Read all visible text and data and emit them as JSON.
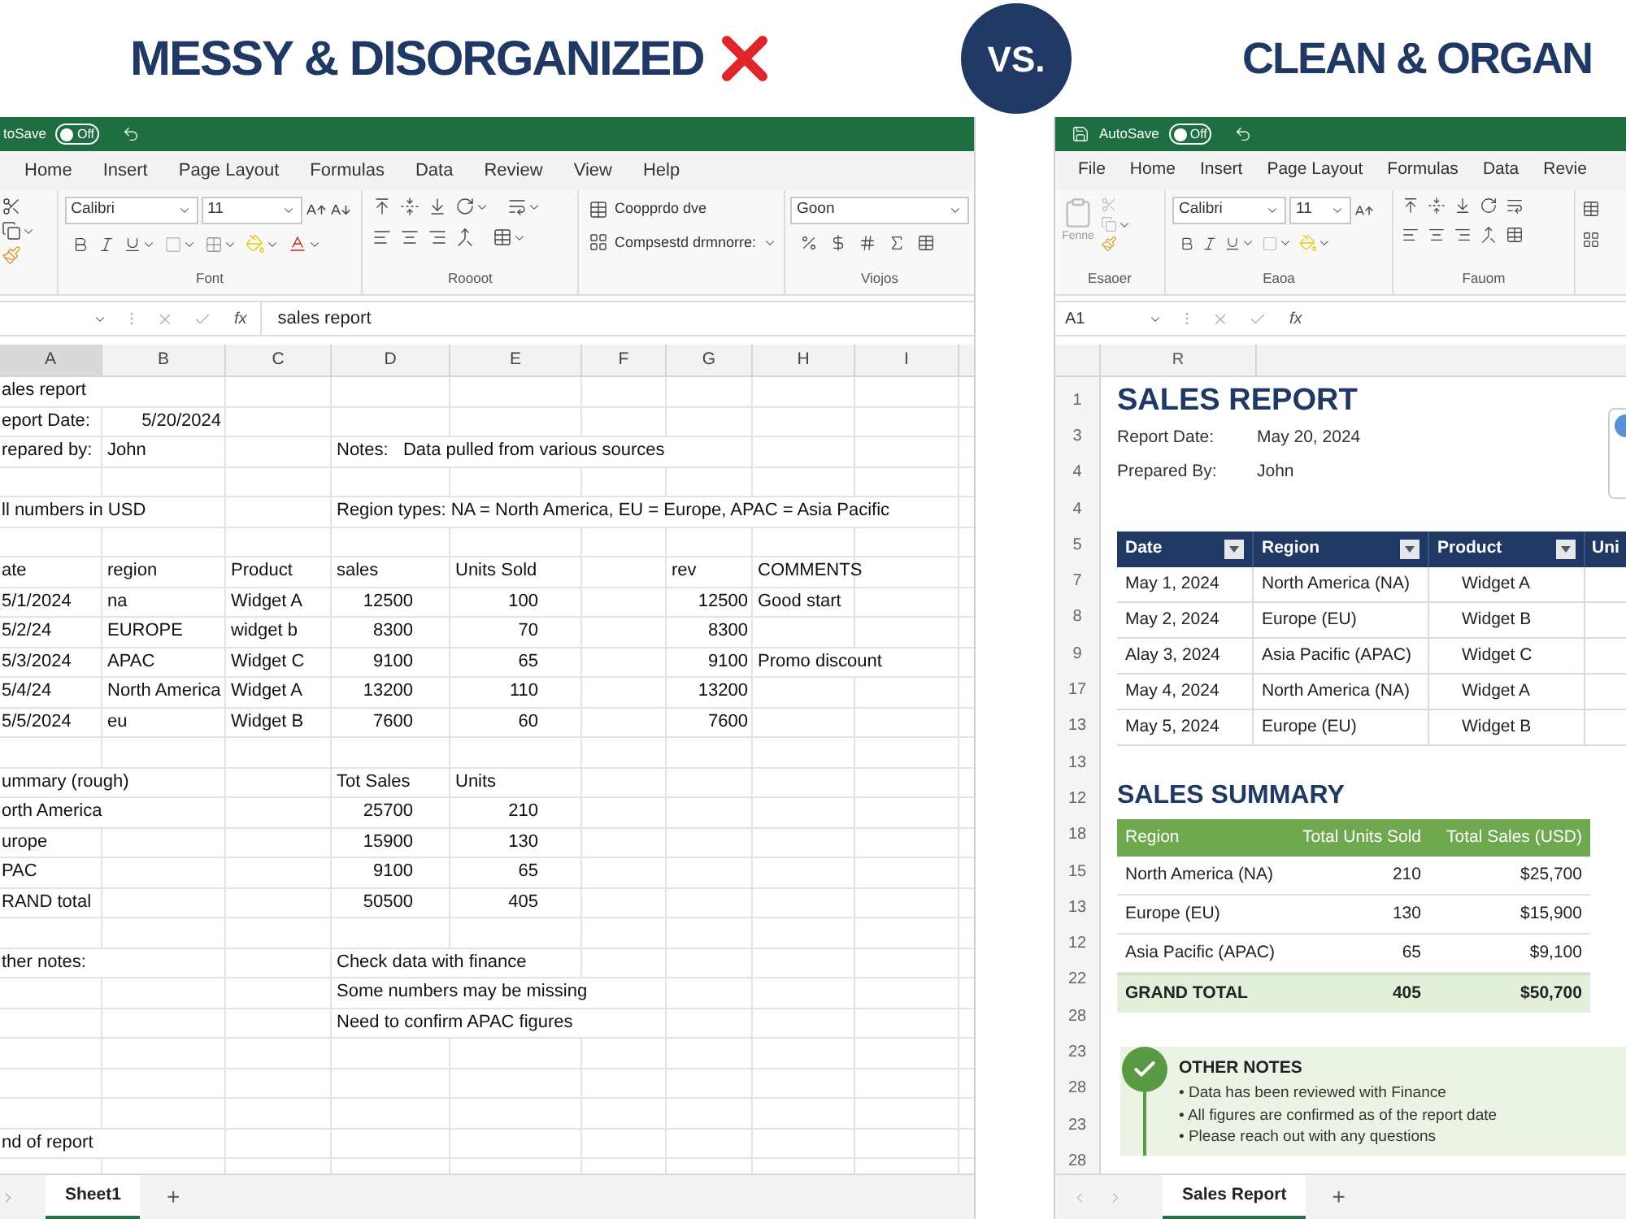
{
  "headline_left": "MESSY & DISORGANIZED",
  "vs_badge": "VS.",
  "headline_right": "CLEAN & ORGAN",
  "left_window": {
    "autosave": {
      "label": "toSave",
      "on": false,
      "toggle_text": "Off"
    },
    "menu": [
      "Home",
      "Insert",
      "Page Layout",
      "Formulas",
      "Data",
      "Review",
      "View",
      "Help"
    ],
    "ribbon": {
      "font": "Calibri",
      "size": "11",
      "cell_style_1": "Coopprdo dve",
      "cell_style_2": "Compsestd drmnorre:",
      "style_box": "Goon",
      "group_labels": [
        "Font",
        "Roooot",
        "Viojos"
      ]
    },
    "formula_bar": {
      "function_label": "fx",
      "formula": "sales report"
    },
    "column_headers": [
      {
        "label": "A",
        "selected": true
      },
      {
        "label": "B",
        "selected": false
      },
      {
        "label": "C",
        "selected": false
      },
      {
        "label": "D",
        "selected": false
      },
      {
        "label": "E",
        "selected": false
      },
      {
        "label": "F",
        "selected": false
      },
      {
        "label": "G",
        "selected": false
      },
      {
        "label": "H",
        "selected": false
      },
      {
        "label": "I",
        "selected": false
      }
    ],
    "rows": [
      {
        "A": {
          "value": "ales report",
          "kind": "text"
        }
      },
      {
        "A": {
          "value": "eport Date:",
          "kind": "text"
        },
        "B": {
          "value": "5/20/2024",
          "kind": "number"
        }
      },
      {
        "A": {
          "value": "repared by:",
          "kind": "text"
        },
        "B": {
          "value": "John",
          "kind": "text"
        },
        "D": {
          "value": "Notes:   Data pulled from various sources",
          "kind": "text"
        }
      },
      {},
      {
        "A": {
          "value": "ll numbers in USD",
          "kind": "text"
        },
        "D": {
          "value": "Region types: NA = North America, EU = Europe, APAC = Asia Pacific",
          "kind": "text"
        }
      },
      {},
      {
        "A": {
          "value": "ate",
          "kind": "text"
        },
        "B": {
          "value": "region",
          "kind": "text"
        },
        "C": {
          "value": "Product",
          "kind": "text"
        },
        "D": {
          "value": "sales",
          "kind": "text"
        },
        "E": {
          "value": "Units Sold",
          "kind": "text"
        },
        "G": {
          "value": "rev",
          "kind": "text"
        },
        "H": {
          "value": "COMMENTS",
          "kind": "text"
        }
      },
      {
        "A": {
          "value": "5/1/2024",
          "kind": "text"
        },
        "B": {
          "value": "na",
          "kind": "text"
        },
        "C": {
          "value": "Widget A",
          "kind": "text"
        },
        "D": {
          "value": "12500",
          "kind": "number"
        },
        "E": {
          "value": "100",
          "kind": "number"
        },
        "G": {
          "value": "12500",
          "kind": "number"
        },
        "H": {
          "value": "Good start",
          "kind": "text"
        }
      },
      {
        "A": {
          "value": "5/2/24",
          "kind": "text"
        },
        "B": {
          "value": "EUROPE",
          "kind": "text"
        },
        "C": {
          "value": "widget b",
          "kind": "text"
        },
        "D": {
          "value": "8300",
          "kind": "number"
        },
        "E": {
          "value": "70",
          "kind": "number"
        },
        "G": {
          "value": "8300",
          "kind": "number"
        }
      },
      {
        "A": {
          "value": "5/3/2024",
          "kind": "text"
        },
        "B": {
          "value": "APAC",
          "kind": "text"
        },
        "C": {
          "value": "Widget C",
          "kind": "text"
        },
        "D": {
          "value": "9100",
          "kind": "number"
        },
        "E": {
          "value": "65",
          "kind": "number"
        },
        "G": {
          "value": "9100",
          "kind": "number"
        },
        "H": {
          "value": "Promo discount",
          "kind": "text"
        }
      },
      {
        "A": {
          "value": "5/4/24",
          "kind": "text"
        },
        "B": {
          "value": "North America",
          "kind": "text"
        },
        "C": {
          "value": "Widget A",
          "kind": "text"
        },
        "D": {
          "value": "13200",
          "kind": "number"
        },
        "E": {
          "value": "110",
          "kind": "number"
        },
        "G": {
          "value": "13200",
          "kind": "number"
        }
      },
      {
        "A": {
          "value": "5/5/2024",
          "kind": "text"
        },
        "B": {
          "value": "eu",
          "kind": "text"
        },
        "C": {
          "value": "Widget B",
          "kind": "text"
        },
        "D": {
          "value": "7600",
          "kind": "number"
        },
        "E": {
          "value": "60",
          "kind": "number"
        },
        "G": {
          "value": "7600",
          "kind": "number"
        }
      },
      {},
      {
        "A": {
          "value": "ummary (rough)",
          "kind": "text"
        },
        "D": {
          "value": "Tot Sales",
          "kind": "text"
        },
        "E": {
          "value": "Units",
          "kind": "text"
        }
      },
      {
        "A": {
          "value": "orth America",
          "kind": "text"
        },
        "D": {
          "value": "25700",
          "kind": "number"
        },
        "E": {
          "value": "210",
          "kind": "number"
        }
      },
      {
        "A": {
          "value": "urope",
          "kind": "text"
        },
        "D": {
          "value": "15900",
          "kind": "number"
        },
        "E": {
          "value": "130",
          "kind": "number"
        }
      },
      {
        "A": {
          "value": "PAC",
          "kind": "text"
        },
        "D": {
          "value": "9100",
          "kind": "number"
        },
        "E": {
          "value": "65",
          "kind": "number"
        }
      },
      {
        "A": {
          "value": "RAND total",
          "kind": "text"
        },
        "D": {
          "value": "50500",
          "kind": "number"
        },
        "E": {
          "value": "405",
          "kind": "number"
        }
      },
      {},
      {
        "A": {
          "value": "ther notes:",
          "kind": "text"
        },
        "D": {
          "value": "Check data with finance",
          "kind": "text"
        }
      },
      {
        "D": {
          "value": "Some numbers may be missing",
          "kind": "text"
        }
      },
      {
        "D": {
          "value": "Need to confirm APAC figures",
          "kind": "text"
        }
      },
      {},
      {},
      {},
      {
        "A": {
          "value": "nd of report",
          "kind": "text"
        }
      },
      {}
    ],
    "sheet_tabs": [
      {
        "label": "Sheet1",
        "selected": true
      }
    ],
    "add_sheet": "+"
  },
  "right_window": {
    "autosave": {
      "label": "AutoSave",
      "on": false,
      "toggle_text": "Off"
    },
    "menu": [
      "File",
      "Home",
      "Insert",
      "Page Layout",
      "Formulas",
      "Data",
      "Revie"
    ],
    "ribbon": {
      "paste": "Fenne",
      "font": "Calibri",
      "size": "11",
      "group_labels": [
        "Esaoer",
        "Eaoa",
        "Fauom"
      ]
    },
    "formula_bar": {
      "name_box": "A1",
      "function_label": "fx"
    },
    "column_headers": [
      "R"
    ],
    "row_numbers": [
      "1",
      "3",
      "4",
      "4",
      "5",
      "7",
      "8",
      "9",
      "17",
      "13",
      "13",
      "12",
      "18",
      "15",
      "13",
      "12",
      "22",
      "28",
      "23",
      "28",
      "23",
      "28"
    ],
    "report": {
      "title": "SALES REPORT",
      "fields": [
        {
          "label": "Report Date:",
          "value": "May 20, 2024"
        },
        {
          "label": "Prepared By:",
          "value": "John"
        }
      ],
      "table": {
        "columns": [
          "Date",
          "Region",
          "Product",
          "Uni"
        ],
        "rows": [
          [
            "May 1, 2024",
            "North America (NA)",
            "Widget A"
          ],
          [
            "May 2, 2024",
            "Europe (EU)",
            "Widget B"
          ],
          [
            "Alay 3, 2024",
            "Asia Pacific (APAC)",
            "Widget C"
          ],
          [
            "May 4, 2024",
            "North America (NA)",
            "Widget A"
          ],
          [
            "May 5, 2024",
            "Europe (EU)",
            "Widget B"
          ]
        ]
      }
    },
    "summary": {
      "title": "SALES SUMMARY",
      "columns": [
        "Region",
        "Total Units Sold",
        "Total Sales (USD)"
      ],
      "rows": [
        [
          "North America (NA)",
          "210",
          "$25,700"
        ],
        [
          "Europe (EU)",
          "130",
          "$15,900"
        ],
        [
          "Asia Pacific (APAC)",
          "65",
          "$9,100"
        ]
      ],
      "total": [
        "GRAND TOTAL",
        "405",
        "$50,700"
      ]
    },
    "notes": {
      "title": "OTHER NOTES",
      "items": [
        "• Data has been reviewed with Finance",
        "• All figures are confirmed as of the report date",
        "• Please reach out with any questions"
      ]
    },
    "sheet_tabs": [
      {
        "label": "Sales Report",
        "selected": true
      }
    ],
    "add_sheet": "+"
  }
}
